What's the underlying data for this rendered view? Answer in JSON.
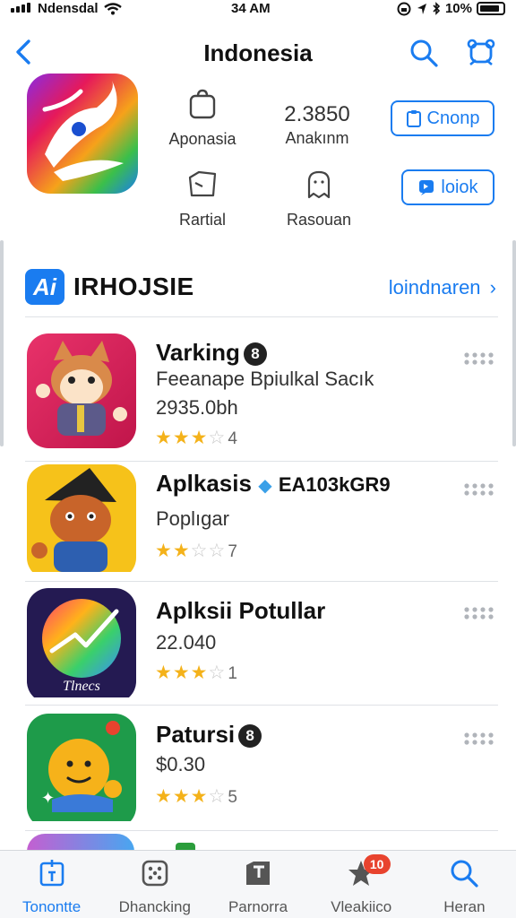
{
  "status": {
    "carrier": "Ndensdal",
    "time": "34 AM",
    "battery": "10%"
  },
  "nav": {
    "title": "Indonesia"
  },
  "hero": {
    "meta": [
      {
        "icon": "bag-icon",
        "label": "Aponasia"
      },
      {
        "value": "2.3850",
        "label": "Anakınm"
      },
      {
        "icon": "box-icon",
        "label": "Rartial"
      },
      {
        "icon": "ghost-icon",
        "label": "Rasouan"
      }
    ],
    "pill_primary": "Cnonp",
    "pill_secondary": "loiok"
  },
  "section": {
    "logo": "Ai",
    "name": "IRHOJSIE",
    "more": "loindnaren"
  },
  "apps": [
    {
      "name": "Varking",
      "badge": "8",
      "lines": [
        "Feeanape Bpiulkal Sacık",
        "2935.0bh"
      ],
      "stars": 3.5,
      "count": "4"
    },
    {
      "name": "Aplkasis",
      "tag": "EA103kGR9",
      "lines": [
        "Poplıgar"
      ],
      "stars": 2.5,
      "count": "7"
    },
    {
      "name": "Aplksii Potullar",
      "lines": [
        "22.040"
      ],
      "stars": 3.5,
      "count": "1",
      "icon_text": "Tlnecs"
    },
    {
      "name": "Patursi",
      "badge": "8",
      "lines": [
        "$0.30"
      ],
      "stars": 3.5,
      "count": "5"
    }
  ],
  "tabs": [
    {
      "label": "Tonontte",
      "icon": "today-icon",
      "active": true
    },
    {
      "label": "Dhancking",
      "icon": "dice-icon"
    },
    {
      "label": "Parnorra",
      "icon": "tag-icon"
    },
    {
      "label": "Vleakiico",
      "icon": "star-icon",
      "badge": "10"
    },
    {
      "label": "Heran",
      "icon": "search-icon"
    }
  ],
  "colors": {
    "accent": "#1a7cf0",
    "star": "#f4b21a",
    "badge": "#e8432e"
  }
}
